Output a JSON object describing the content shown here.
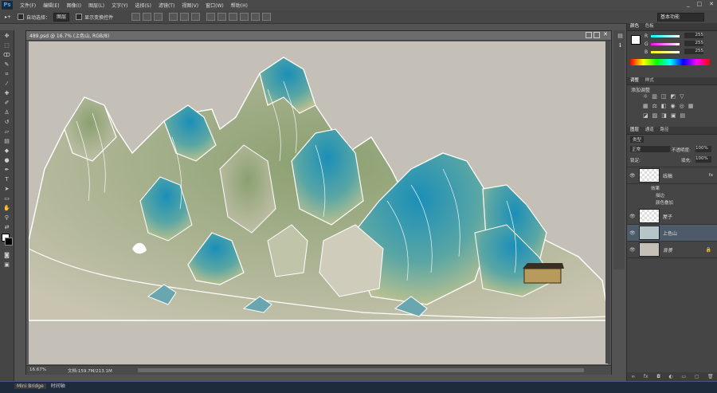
{
  "app": {
    "logo": "Ps",
    "win_controls": [
      "_",
      "□",
      "✕"
    ]
  },
  "menu": [
    "文件(F)",
    "编辑(E)",
    "图像(I)",
    "图层(L)",
    "文字(Y)",
    "选择(S)",
    "滤镜(T)",
    "视图(V)",
    "窗口(W)",
    "帮助(H)"
  ],
  "options": {
    "auto_select_label": "自动选择：",
    "auto_select_value": "图层",
    "show_transform_label": "显示变换控件",
    "workspace": "基本功能"
  },
  "document": {
    "title": "489.psd @ 16.7% (上色山, RGB/8)",
    "zoom": "16.67%",
    "doc_info": "文档:159.7M/213.1M"
  },
  "panels": {
    "color_tabs": [
      "颜色",
      "色板"
    ],
    "color": {
      "r_label": "R",
      "g_label": "G",
      "b_label": "B",
      "r": "255",
      "g": "255",
      "b": "255"
    },
    "adjust_tabs": [
      "调整",
      "样式"
    ],
    "adjust_title": "添加调整",
    "layer_tabs": [
      "图层",
      "通道",
      "路径"
    ],
    "kind": "类型",
    "blend": "正常",
    "opacity_label": "不透明度:",
    "opacity": "100%",
    "lock_label": "锁定:",
    "fill_label": "填充:",
    "fill": "100%",
    "layers": [
      {
        "name": "线稿",
        "fx": "fx"
      },
      {
        "name": "效果"
      },
      {
        "name": "描边"
      },
      {
        "name": "颜色叠加"
      },
      {
        "name": "屋子"
      },
      {
        "name": "上色山"
      },
      {
        "name": "背景"
      }
    ]
  },
  "taskbar": {
    "mini_bridge": "Mini Bridge",
    "timeline": "时间轴"
  },
  "colors": {
    "accent_blue": "#3ea6ff",
    "panel_bg": "#454545",
    "canvas_bg": "#c4c0b8"
  }
}
